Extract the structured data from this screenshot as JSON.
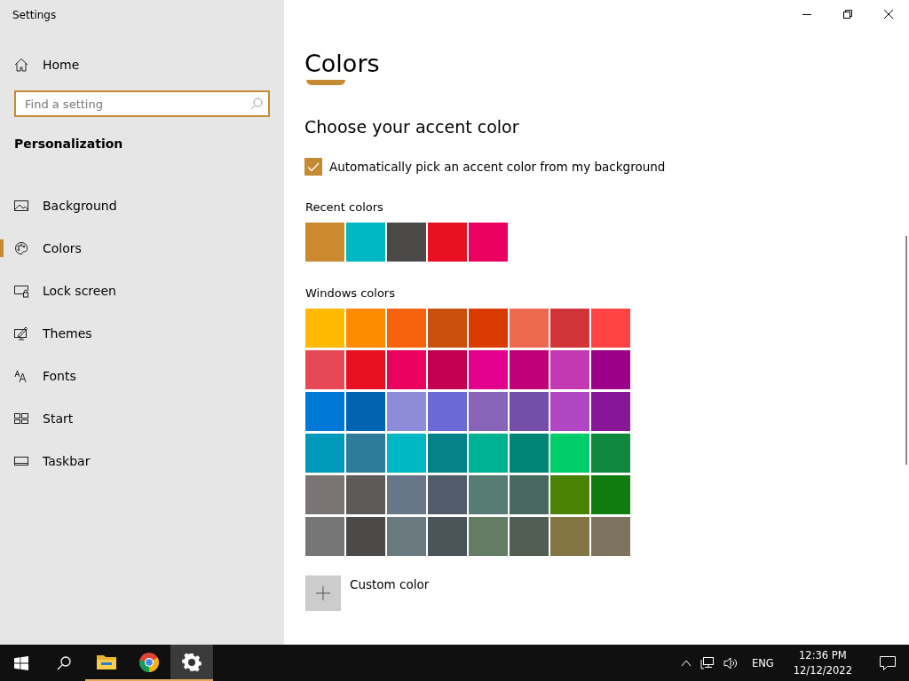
{
  "window": {
    "title": "Settings"
  },
  "sidebar": {
    "home": "Home",
    "search": {
      "placeholder": "Find a setting"
    },
    "section": "Personalization",
    "items": [
      {
        "label": "Background",
        "kind": "background",
        "selected": false
      },
      {
        "label": "Colors",
        "kind": "colors",
        "selected": true
      },
      {
        "label": "Lock screen",
        "kind": "lock",
        "selected": false
      },
      {
        "label": "Themes",
        "kind": "themes",
        "selected": false
      },
      {
        "label": "Fonts",
        "kind": "fonts",
        "selected": false
      },
      {
        "label": "Start",
        "kind": "start",
        "selected": false
      },
      {
        "label": "Taskbar",
        "kind": "taskbar",
        "selected": false
      }
    ]
  },
  "content": {
    "title": "Colors",
    "accent_heading": "Choose your accent color",
    "auto_pick": {
      "label": "Automatically pick an accent color from my background",
      "checked": true
    },
    "recent_label": "Recent colors",
    "recent_colors": [
      {
        "color": "#cc8a2e"
      },
      {
        "color": "#00b7c3"
      },
      {
        "color": "#4c4a48"
      },
      {
        "color": "#e81123"
      },
      {
        "color": "#ea005e"
      }
    ],
    "windows_label": "Windows colors",
    "windows_colors": [
      {
        "color": "#ffb900"
      },
      {
        "color": "#ff8c00"
      },
      {
        "color": "#f7630c"
      },
      {
        "color": "#ca5010"
      },
      {
        "color": "#da3b01"
      },
      {
        "color": "#ef6950"
      },
      {
        "color": "#d13438"
      },
      {
        "color": "#ff4343"
      },
      {
        "color": "#e74856"
      },
      {
        "color": "#e81123"
      },
      {
        "color": "#ea005e"
      },
      {
        "color": "#c30052"
      },
      {
        "color": "#e3008c"
      },
      {
        "color": "#bf0077"
      },
      {
        "color": "#c239b3"
      },
      {
        "color": "#9a0089"
      },
      {
        "color": "#0078d7"
      },
      {
        "color": "#0063b1"
      },
      {
        "color": "#8e8cd8"
      },
      {
        "color": "#6b69d6"
      },
      {
        "color": "#8764b8"
      },
      {
        "color": "#744da9"
      },
      {
        "color": "#b146c2"
      },
      {
        "color": "#881798"
      },
      {
        "color": "#0099bc"
      },
      {
        "color": "#2d7d9a"
      },
      {
        "color": "#00b7c3"
      },
      {
        "color": "#038387"
      },
      {
        "color": "#00b294"
      },
      {
        "color": "#018574"
      },
      {
        "color": "#00cc6a"
      },
      {
        "color": "#10893e"
      },
      {
        "color": "#7a7574"
      },
      {
        "color": "#5d5a58"
      },
      {
        "color": "#68768a"
      },
      {
        "color": "#515c6b"
      },
      {
        "color": "#567c73"
      },
      {
        "color": "#486860"
      },
      {
        "color": "#498205"
      },
      {
        "color": "#107c10"
      },
      {
        "color": "#767676"
      },
      {
        "color": "#4c4a48"
      },
      {
        "color": "#69797e"
      },
      {
        "color": "#4a5459"
      },
      {
        "color": "#647c64"
      },
      {
        "color": "#525e54"
      },
      {
        "color": "#847545"
      },
      {
        "color": "#7e735f"
      }
    ],
    "custom_color": "Custom color"
  },
  "taskbar": {
    "apps": [
      {
        "kind": "explorer",
        "selected": false
      },
      {
        "kind": "chrome",
        "selected": false
      },
      {
        "kind": "settings",
        "selected": true
      }
    ],
    "language": "ENG",
    "time": "12:36 PM",
    "date": "12/12/2022"
  }
}
